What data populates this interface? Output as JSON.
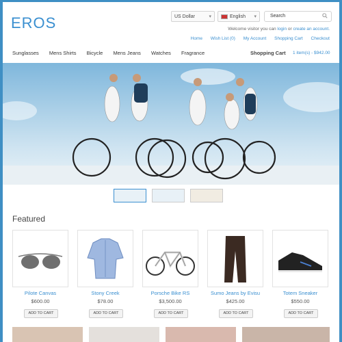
{
  "header": {
    "logo": "EROS",
    "currency": "US Dollar",
    "language": "English",
    "search_placeholder": "Search",
    "welcome_prefix": "Welcome visitor you can",
    "login": "login",
    "or": "or",
    "create_account": "create an account.",
    "links": [
      "Home",
      "Wish List (0)",
      "My Account",
      "Shopping Cart",
      "Checkout"
    ]
  },
  "nav": {
    "items": [
      "Sunglasses",
      "Mens Shirts",
      "Bicycle",
      "Mens Jeans",
      "Watches",
      "Fragrance"
    ],
    "cart_title": "Shopping Cart",
    "cart_info": "1 item(s) - $942.00"
  },
  "featured": {
    "title": "Featured",
    "add_label": "ADD TO CART",
    "products": [
      {
        "name": "Pilote Canvas",
        "price": "$600.00",
        "icon": "sunglasses-icon"
      },
      {
        "name": "Stony Creek",
        "price": "$78.00",
        "icon": "shirt-icon"
      },
      {
        "name": "Porsche Bike RS",
        "price": "$3,500.00",
        "icon": "bicycle-icon"
      },
      {
        "name": "Sumo Jeans by Evisu",
        "price": "$425.00",
        "icon": "jeans-icon"
      },
      {
        "name": "Totem Sneaker",
        "price": "$550.00",
        "icon": "sneaker-icon"
      }
    ]
  },
  "colors": {
    "accent": "#3a8fd0",
    "frame": "#3f8fc4"
  }
}
